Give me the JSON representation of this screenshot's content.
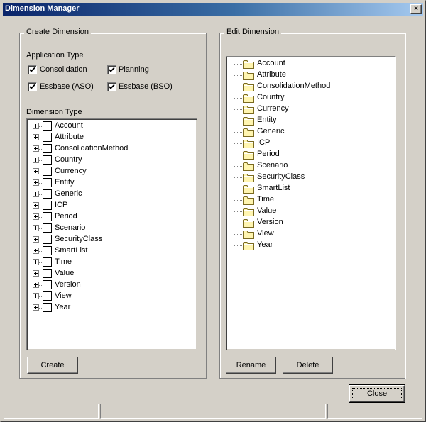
{
  "window": {
    "title": "Dimension Manager",
    "close_glyph": "×"
  },
  "create_group": {
    "legend": "Create Dimension",
    "app_type_label": "Application Type",
    "app_types": [
      {
        "label": "Consolidation",
        "checked": true
      },
      {
        "label": "Planning",
        "checked": true
      },
      {
        "label": "Essbase (ASO)",
        "checked": true
      },
      {
        "label": "Essbase (BSO)",
        "checked": true
      }
    ],
    "dim_type_label": "Dimension Type",
    "dimension_types": [
      "Account",
      "Attribute",
      "ConsolidationMethod",
      "Country",
      "Currency",
      "Entity",
      "Generic",
      "ICP",
      "Period",
      "Scenario",
      "SecurityClass",
      "SmartList",
      "Time",
      "Value",
      "Version",
      "View",
      "Year"
    ],
    "create_button": "Create"
  },
  "edit_group": {
    "legend": "Edit Dimension",
    "dimensions": [
      "Account",
      "Attribute",
      "ConsolidationMethod",
      "Country",
      "Currency",
      "Entity",
      "Generic",
      "ICP",
      "Period",
      "Scenario",
      "SecurityClass",
      "SmartList",
      "Time",
      "Value",
      "Version",
      "View",
      "Year"
    ],
    "rename_button": "Rename",
    "delete_button": "Delete"
  },
  "footer": {
    "close_button": "Close"
  },
  "colors": {
    "title_start": "#0a246a",
    "title_end": "#a6caf0",
    "folder": "#fff5b0",
    "face": "#d4d0c8"
  }
}
